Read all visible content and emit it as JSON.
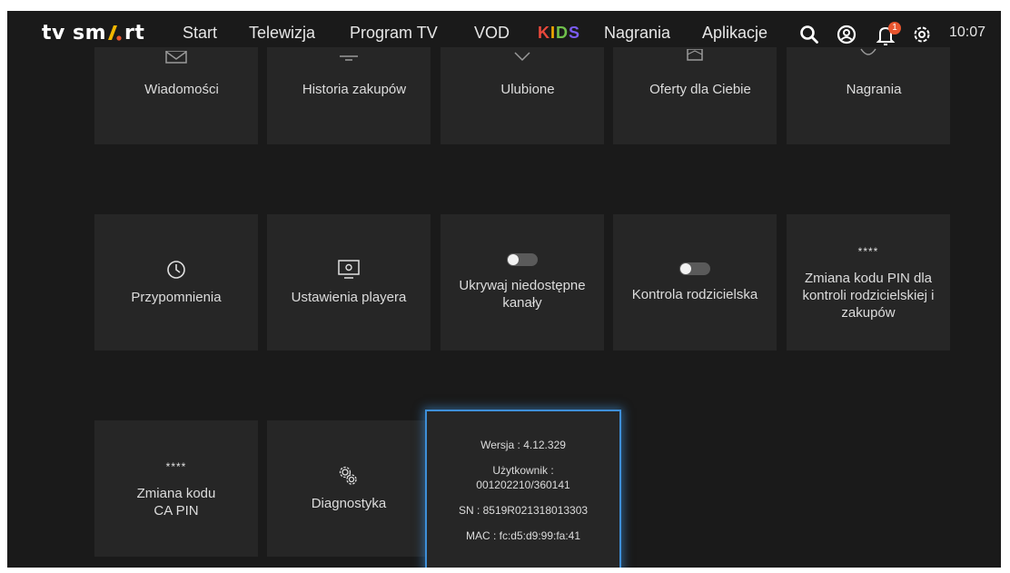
{
  "brand": {
    "logo_prefix": "tv sm",
    "logo_suffix": "rt",
    "logo_accent_colors": [
      "#f2b600",
      "#e8552e"
    ]
  },
  "nav": {
    "items": [
      {
        "label": "Start"
      },
      {
        "label": "Telewizja"
      },
      {
        "label": "Program TV"
      },
      {
        "label": "VOD"
      },
      {
        "label": "KIDS",
        "colors": [
          "#e8483b",
          "#f2a900",
          "#6fc04b",
          "#7b5cf0"
        ]
      },
      {
        "label": "Nagrania"
      },
      {
        "label": "Aplikacje"
      }
    ],
    "icons": [
      "search-icon",
      "profile-icon",
      "bell-icon",
      "gear-icon"
    ],
    "notification_count": "1",
    "clock": "10:07"
  },
  "tiles_row1": [
    {
      "label": "Wiadomości",
      "icon": "envelope-icon"
    },
    {
      "label": "Historia zakupów",
      "icon": "monitor-icon"
    },
    {
      "label": "Ulubione",
      "icon": "heart-icon"
    },
    {
      "label": "Oferty dla Ciebie",
      "icon": "offer-icon"
    },
    {
      "label": "Nagrania",
      "icon": "rec-icon"
    }
  ],
  "tiles_row2": [
    {
      "label": "Przypomnienia",
      "icon": "clock-icon"
    },
    {
      "label": "Ustawienia playera",
      "icon": "player-settings-icon"
    },
    {
      "label": "Ukrywaj niedostępne kanały",
      "icon": "toggle",
      "toggle": "off"
    },
    {
      "label": "Kontrola rodzicielska",
      "icon": "toggle",
      "toggle": "off"
    },
    {
      "label": "Zmiana kodu PIN dla kontroli rodzicielskiej i zakupów",
      "icon": "stars",
      "stars": "****"
    }
  ],
  "tiles_row3": [
    {
      "label": "Zmiana kodu CA PIN",
      "icon": "stars",
      "stars": "****"
    },
    {
      "label": "Diagnostyka",
      "icon": "gears-icon"
    }
  ],
  "info": {
    "version": "Wersja : 4.12.329",
    "user_label": "Użytkownik :",
    "user_value": "001202210/360141",
    "sn": "SN : 8519R021318013303",
    "mac": "MAC : fc:d5:d9:99:fa:41"
  },
  "colors": {
    "background": "#1a1a1a",
    "tile": "#262626",
    "focus": "#3e8fd8",
    "badge": "#e8552e"
  }
}
